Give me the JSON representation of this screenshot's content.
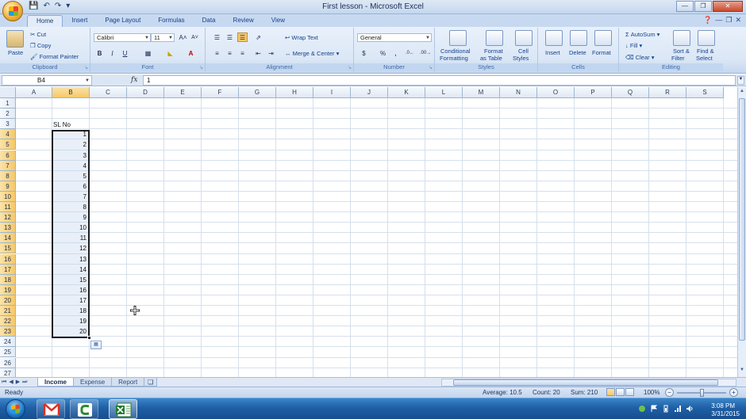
{
  "window": {
    "title": "First lesson - Microsoft Excel"
  },
  "ribbon_tabs": [
    "Home",
    "Insert",
    "Page Layout",
    "Formulas",
    "Data",
    "Review",
    "View"
  ],
  "ribbon": {
    "clipboard": {
      "label": "Clipboard",
      "paste": "Paste",
      "cut": "Cut",
      "copy": "Copy",
      "format_painter": "Format Painter"
    },
    "font": {
      "label": "Font",
      "name": "Calibri",
      "size": "11"
    },
    "alignment": {
      "label": "Alignment",
      "wrap_text": "Wrap Text",
      "merge_center": "Merge & Center"
    },
    "number": {
      "label": "Number",
      "format": "General"
    },
    "styles": {
      "label": "Styles",
      "conditional_1": "Conditional",
      "conditional_2": "Formatting",
      "format_table_1": "Format",
      "format_table_2": "as Table",
      "cell_styles_1": "Cell",
      "cell_styles_2": "Styles"
    },
    "cells": {
      "label": "Cells",
      "insert": "Insert",
      "delete": "Delete",
      "format": "Format"
    },
    "editing": {
      "label": "Editing",
      "autosum": "AutoSum",
      "fill": "Fill",
      "clear": "Clear",
      "sort_1": "Sort &",
      "sort_2": "Filter",
      "find_1": "Find &",
      "find_2": "Select"
    }
  },
  "formula_bar": {
    "name_box": "B4",
    "fx": "fx",
    "value": "1"
  },
  "columns": [
    "A",
    "B",
    "C",
    "D",
    "E",
    "F",
    "G",
    "H",
    "I",
    "J",
    "K",
    "L",
    "M",
    "N",
    "O",
    "P",
    "Q",
    "R",
    "S"
  ],
  "rows": [
    "1",
    "2",
    "3",
    "4",
    "5",
    "6",
    "7",
    "8",
    "9",
    "10",
    "11",
    "12",
    "13",
    "14",
    "15",
    "16",
    "17",
    "18",
    "19",
    "20",
    "21",
    "22",
    "23",
    "24",
    "25",
    "26",
    "27"
  ],
  "cells": {
    "b3_header": "SL No",
    "b_values": [
      "1",
      "2",
      "3",
      "4",
      "5",
      "6",
      "7",
      "8",
      "9",
      "10",
      "11",
      "12",
      "13",
      "14",
      "15",
      "16",
      "17",
      "18",
      "19",
      "20"
    ]
  },
  "sheets": [
    "Income",
    "Expense",
    "Report"
  ],
  "active_sheet": "Income",
  "status": {
    "mode": "Ready",
    "average": "Average: 10.5",
    "count": "Count: 20",
    "sum": "Sum: 210",
    "zoom": "100%"
  },
  "taskbar": {
    "time": "3:08 PM",
    "date": "3/31/2015",
    "apps": [
      "gmail-app-icon",
      "camtasia-app-icon",
      "excel-app-icon"
    ]
  },
  "colors": {
    "accent": "#1f5fa6",
    "selected_header": "#f6c86a",
    "ribbon_bg": "#dbe7f6"
  }
}
